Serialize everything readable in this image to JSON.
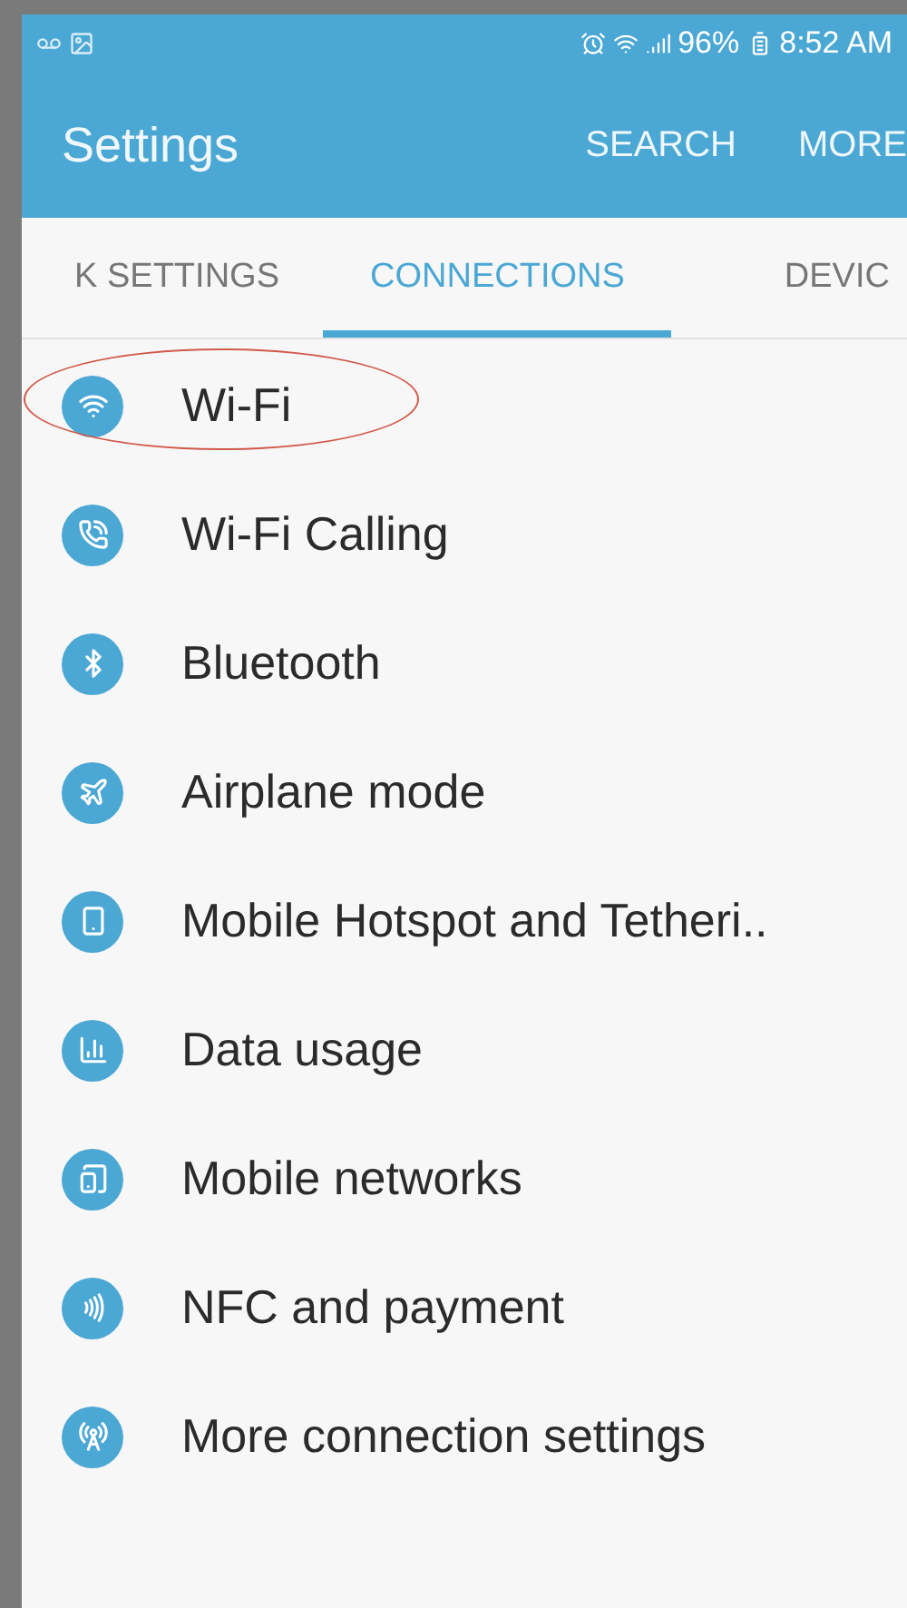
{
  "status_bar": {
    "battery": "96%",
    "time": "8:52 AM"
  },
  "app_bar": {
    "title": "Settings",
    "actions": [
      "SEARCH",
      "MORE"
    ]
  },
  "tabs": [
    {
      "label": "K SETTINGS",
      "selected": false
    },
    {
      "label": "CONNECTIONS",
      "selected": true
    },
    {
      "label": "DEVIC",
      "selected": false
    }
  ],
  "items": [
    {
      "label": "Wi-Fi",
      "circled": true
    },
    {
      "label": "Wi-Fi Calling",
      "circled": false
    },
    {
      "label": "Bluetooth",
      "circled": false
    },
    {
      "label": "Airplane mode",
      "circled": false
    },
    {
      "label": "Mobile Hotspot and Tetheri..",
      "circled": false
    },
    {
      "label": "Data usage",
      "circled": false
    },
    {
      "label": "Mobile networks",
      "circled": false
    },
    {
      "label": "NFC and payment",
      "circled": false
    },
    {
      "label": "More connection settings",
      "circled": false
    }
  ]
}
